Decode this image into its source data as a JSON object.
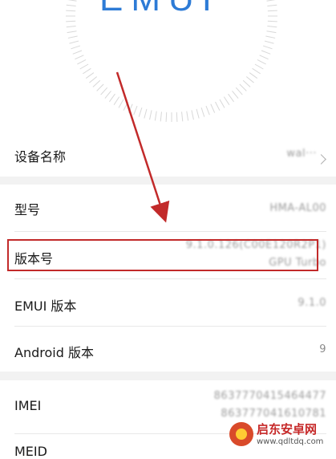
{
  "header": {
    "logo_text": "EMUI"
  },
  "rows": [
    {
      "label": "设备名称",
      "value": "wal···",
      "has_chevron": true
    },
    {
      "label": "型号",
      "value": "HMA-AL00"
    },
    {
      "label": "版本号",
      "value_line1": "9.1.0.126(C00E120R2P1)",
      "value_line2": "GPU Turbo"
    },
    {
      "label": "EMUI 版本",
      "value": "9.1.0"
    },
    {
      "label": "Android 版本",
      "value": "9"
    },
    {
      "label": "IMEI",
      "value_line1": "8637770415464477",
      "value_line2": "863777041610781"
    },
    {
      "label": "MEID",
      "value": ""
    }
  ],
  "watermark": {
    "title": "启东安卓网",
    "url": "www.qdltdq.com"
  },
  "colors": {
    "annotation_red": "#c22a2a",
    "section_gap": "#f2f2f2"
  }
}
